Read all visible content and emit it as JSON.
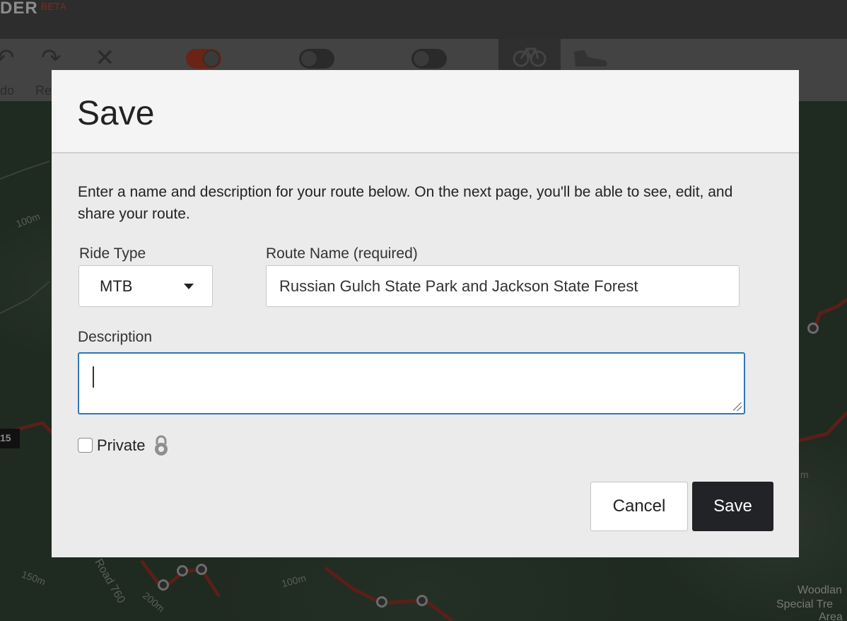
{
  "app": {
    "brand": "DER",
    "beta_label": "BETA",
    "toolbar": {
      "undo_label": "do",
      "redo_label": "Re",
      "undo_icon": "undo-icon",
      "redo_icon": "redo-icon",
      "clear_icon": "close-icon",
      "bike_icon": "bicycle-icon",
      "walk_icon": "shoe-icon"
    },
    "map_labels": {
      "contour_100_top": "100m",
      "route_shield": "15",
      "contour_150": "150m",
      "road": "Road 760",
      "contour_200": "200m",
      "contour_100_bottom": "100m",
      "contour_m": "m",
      "woodland": "Woodlan",
      "special": "Special Tre",
      "area": "Area"
    }
  },
  "modal": {
    "title": "Save",
    "intro": "Enter a name and description for your route below. On the next page, you'll be able to see, edit, and share your route.",
    "ride_type": {
      "label": "Ride Type",
      "value": "MTB"
    },
    "route_name": {
      "label": "Route Name (required)",
      "value": "Russian Gulch State Park and Jackson State Forest"
    },
    "description": {
      "label": "Description",
      "value": ""
    },
    "private": {
      "label": "Private",
      "checked": false,
      "icon": "lock-icon"
    },
    "buttons": {
      "cancel": "Cancel",
      "save": "Save"
    }
  },
  "colors": {
    "primary_button": "#222326",
    "focus_border": "#2f77b8",
    "modal_background": "#ebebeb"
  }
}
